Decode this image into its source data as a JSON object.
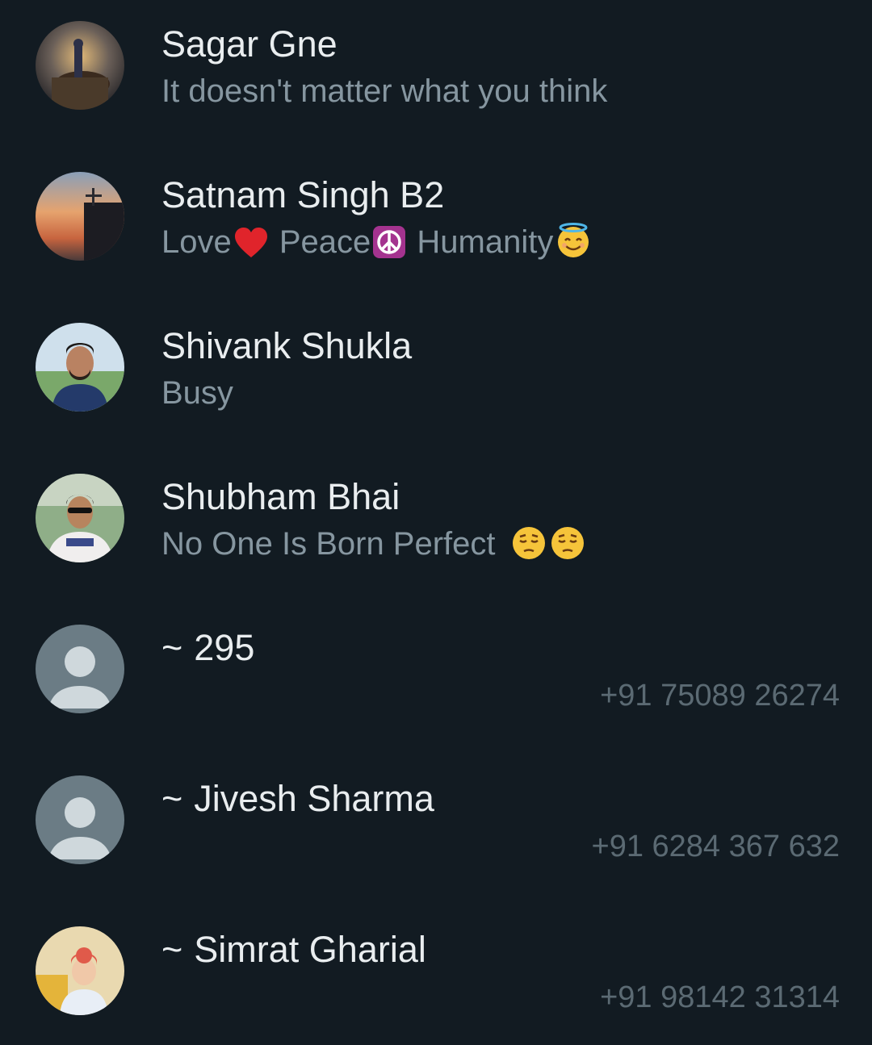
{
  "contacts": [
    {
      "name": "Sagar Gne",
      "status": "It doesn't matter what you think",
      "avatar_icon": "photo-avatar-icon"
    },
    {
      "name": "Satnam Singh B2",
      "status_parts": [
        "Love",
        "Peace",
        "Humanity"
      ],
      "status_icons": [
        "red-heart-icon",
        "peace-symbol-icon",
        "smiling-halo-icon"
      ],
      "avatar_icon": "photo-avatar-icon"
    },
    {
      "name": "Shivank Shukla",
      "status": "Busy",
      "avatar_icon": "photo-avatar-icon"
    },
    {
      "name": "Shubham Bhai",
      "status": "No One Is Born Perfect",
      "status_icons": [
        "pensive-face-icon",
        "pensive-face-icon"
      ],
      "avatar_icon": "photo-avatar-icon"
    },
    {
      "prefix": "~",
      "name": "295",
      "phone": "+91 75089 26274",
      "avatar_icon": "default-person-avatar-icon"
    },
    {
      "prefix": "~",
      "name": "Jivesh Sharma",
      "phone": "+91 6284 367 632",
      "avatar_icon": "default-person-avatar-icon"
    },
    {
      "prefix": "~",
      "name": "Simrat Gharial",
      "phone": "+91 98142 31314",
      "avatar_icon": "photo-avatar-icon"
    }
  ],
  "colors": {
    "background": "#121b22",
    "name_text": "#e9edef",
    "status_text": "#8696a0",
    "phone_text": "#5b6a73",
    "default_avatar_bg": "#6b7c85",
    "default_avatar_fg": "#cfd8dc"
  }
}
